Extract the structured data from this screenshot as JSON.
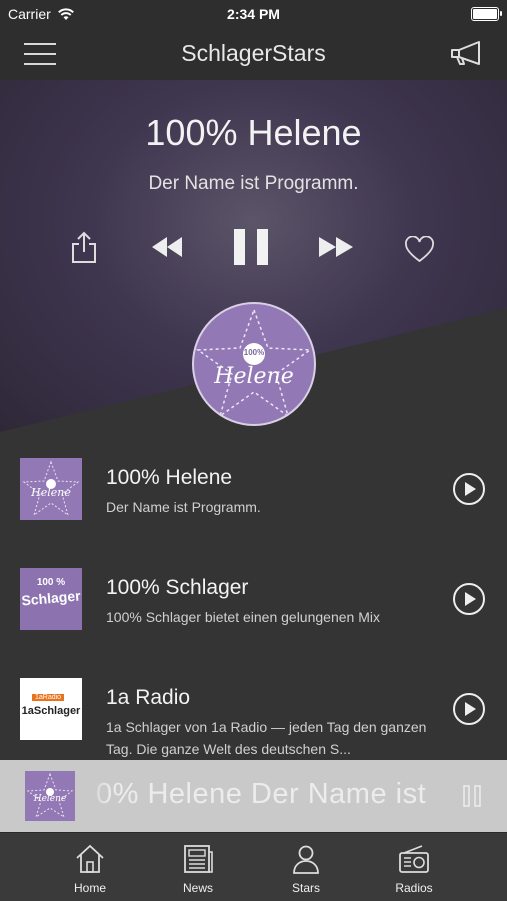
{
  "status": {
    "carrier": "Carrier",
    "time": "2:34 PM"
  },
  "app": {
    "title": "SchlagerStars"
  },
  "now_playing": {
    "station": "100% Helene",
    "tagline": "Der Name ist Programm.",
    "logo_top": "100%",
    "logo_word": "Helene"
  },
  "stations": [
    {
      "name": "100% Helene",
      "desc": "Der Name ist Programm.",
      "logo_top": "100%",
      "logo_word": "Helene"
    },
    {
      "name": "100% Schlager",
      "desc": "100% Schlager bietet einen gelungenen Mix",
      "logo_top": "100 %",
      "logo_word": "Schlager"
    },
    {
      "name": "1a Radio",
      "desc": "1a Schlager von 1a Radio — jeden Tag den ganzen Tag. Die ganze Welt des deutschen S...",
      "logo_top": "1aRadio",
      "logo_word": "1aSchlager"
    }
  ],
  "mini_player": {
    "text": "0% Helene Der Name ist",
    "logo_top": "100%",
    "logo_word": "Helene"
  },
  "tabs": [
    {
      "label": "Home",
      "icon": "home-icon"
    },
    {
      "label": "News",
      "icon": "news-icon"
    },
    {
      "label": "Stars",
      "icon": "person-icon"
    },
    {
      "label": "Radios",
      "icon": "radio-icon"
    }
  ],
  "colors": {
    "accent_purple": "#9279b5",
    "background": "#343434",
    "bar": "#2e2e2e"
  }
}
